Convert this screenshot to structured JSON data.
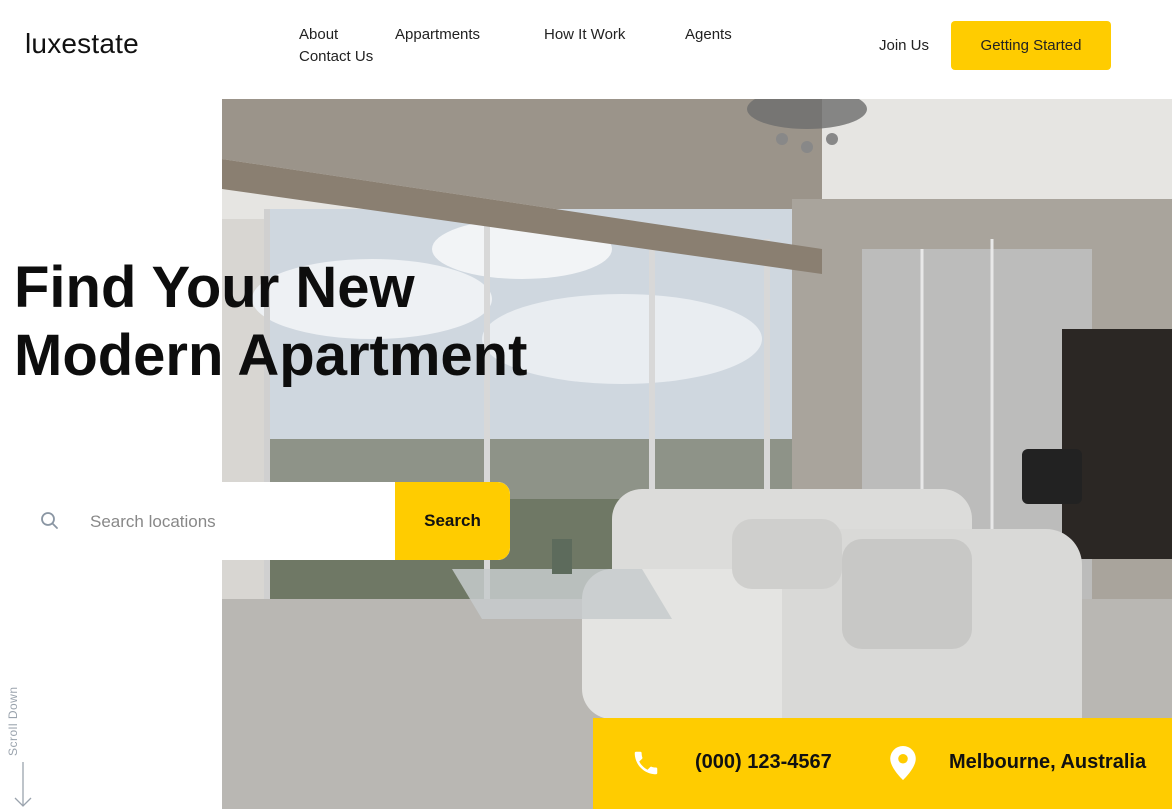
{
  "brand": {
    "logo": "luxestate"
  },
  "nav": {
    "items": [
      {
        "label": "About"
      },
      {
        "label": "Appartments"
      },
      {
        "label": "How It Work"
      },
      {
        "label": "Agents"
      },
      {
        "label": "Contact Us"
      }
    ],
    "join_label": "Join Us",
    "cta_label": "Getting Started"
  },
  "hero": {
    "title_line1": "Find Your New",
    "title_line2": "Modern Apartment",
    "image_icon": "living-room-photo"
  },
  "search": {
    "icon": "search-icon",
    "placeholder": "Search locations",
    "value": "",
    "button_label": "Search"
  },
  "scroll": {
    "label": "Scroll Down",
    "icon": "arrow-down-icon"
  },
  "contact": {
    "phone_icon": "phone-icon",
    "phone": "(000) 123-4567",
    "location_icon": "map-pin-icon",
    "location": "Melbourne, Australia"
  },
  "colors": {
    "accent": "#ffcc00",
    "text": "#111111",
    "muted": "#9aa3ad"
  }
}
